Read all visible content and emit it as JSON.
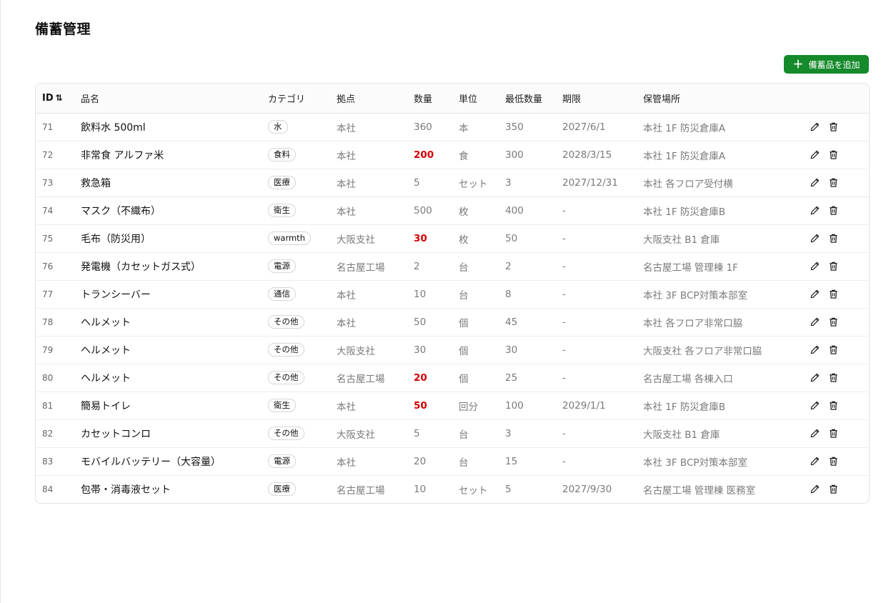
{
  "page": {
    "title": "備蓄管理"
  },
  "toolbar": {
    "add_label": "備蓄品を追加"
  },
  "columns": [
    "ID",
    "品名",
    "カテゴリ",
    "拠点",
    "数量",
    "単位",
    "最低数量",
    "期限",
    "保管場所"
  ],
  "sort_icon": "⇅",
  "rows": [
    {
      "id": "71",
      "name": "飲料水 500ml",
      "category": "水",
      "site": "本社",
      "qty": "360",
      "unit": "本",
      "min": "350",
      "expiry": "2027/6/1",
      "location": "本社 1F 防災倉庫A",
      "low": false
    },
    {
      "id": "72",
      "name": "非常食 アルファ米",
      "category": "食料",
      "site": "本社",
      "qty": "200",
      "unit": "食",
      "min": "300",
      "expiry": "2028/3/15",
      "location": "本社 1F 防災倉庫A",
      "low": true
    },
    {
      "id": "73",
      "name": "救急箱",
      "category": "医療",
      "site": "本社",
      "qty": "5",
      "unit": "セット",
      "min": "3",
      "expiry": "2027/12/31",
      "location": "本社 各フロア受付横",
      "low": false
    },
    {
      "id": "74",
      "name": "マスク（不織布）",
      "category": "衛生",
      "site": "本社",
      "qty": "500",
      "unit": "枚",
      "min": "400",
      "expiry": "-",
      "location": "本社 1F 防災倉庫B",
      "low": false
    },
    {
      "id": "75",
      "name": "毛布（防災用）",
      "category": "warmth",
      "site": "大阪支社",
      "qty": "30",
      "unit": "枚",
      "min": "50",
      "expiry": "-",
      "location": "大阪支社 B1 倉庫",
      "low": true
    },
    {
      "id": "76",
      "name": "発電機（カセットガス式）",
      "category": "電源",
      "site": "名古屋工場",
      "qty": "2",
      "unit": "台",
      "min": "2",
      "expiry": "-",
      "location": "名古屋工場 管理棟 1F",
      "low": false
    },
    {
      "id": "77",
      "name": "トランシーバー",
      "category": "通信",
      "site": "本社",
      "qty": "10",
      "unit": "台",
      "min": "8",
      "expiry": "-",
      "location": "本社 3F BCP対策本部室",
      "low": false
    },
    {
      "id": "78",
      "name": "ヘルメット",
      "category": "その他",
      "site": "本社",
      "qty": "50",
      "unit": "個",
      "min": "45",
      "expiry": "-",
      "location": "本社 各フロア非常口脇",
      "low": false
    },
    {
      "id": "79",
      "name": "ヘルメット",
      "category": "その他",
      "site": "大阪支社",
      "qty": "30",
      "unit": "個",
      "min": "30",
      "expiry": "-",
      "location": "大阪支社 各フロア非常口脇",
      "low": false
    },
    {
      "id": "80",
      "name": "ヘルメット",
      "category": "その他",
      "site": "名古屋工場",
      "qty": "20",
      "unit": "個",
      "min": "25",
      "expiry": "-",
      "location": "名古屋工場 各棟入口",
      "low": true
    },
    {
      "id": "81",
      "name": "簡易トイレ",
      "category": "衛生",
      "site": "本社",
      "qty": "50",
      "unit": "回分",
      "min": "100",
      "expiry": "2029/1/1",
      "location": "本社 1F 防災倉庫B",
      "low": true
    },
    {
      "id": "82",
      "name": "カセットコンロ",
      "category": "その他",
      "site": "大阪支社",
      "qty": "5",
      "unit": "台",
      "min": "3",
      "expiry": "-",
      "location": "大阪支社 B1 倉庫",
      "low": false
    },
    {
      "id": "83",
      "name": "モバイルバッテリー（大容量）",
      "category": "電源",
      "site": "本社",
      "qty": "20",
      "unit": "台",
      "min": "15",
      "expiry": "-",
      "location": "本社 3F BCP対策本部室",
      "low": false
    },
    {
      "id": "84",
      "name": "包帯・消毒液セット",
      "category": "医療",
      "site": "名古屋工場",
      "qty": "10",
      "unit": "セット",
      "min": "5",
      "expiry": "2027/9/30",
      "location": "名古屋工場 管理棟 医務室",
      "low": false
    }
  ],
  "colors": {
    "accent": "#148a2a",
    "low_stock": "#d40000",
    "border": "#e3e3e3"
  },
  "icons": {
    "add": "plus-icon",
    "sort": "sort-icon",
    "edit": "pencil-icon",
    "delete": "trash-icon"
  }
}
